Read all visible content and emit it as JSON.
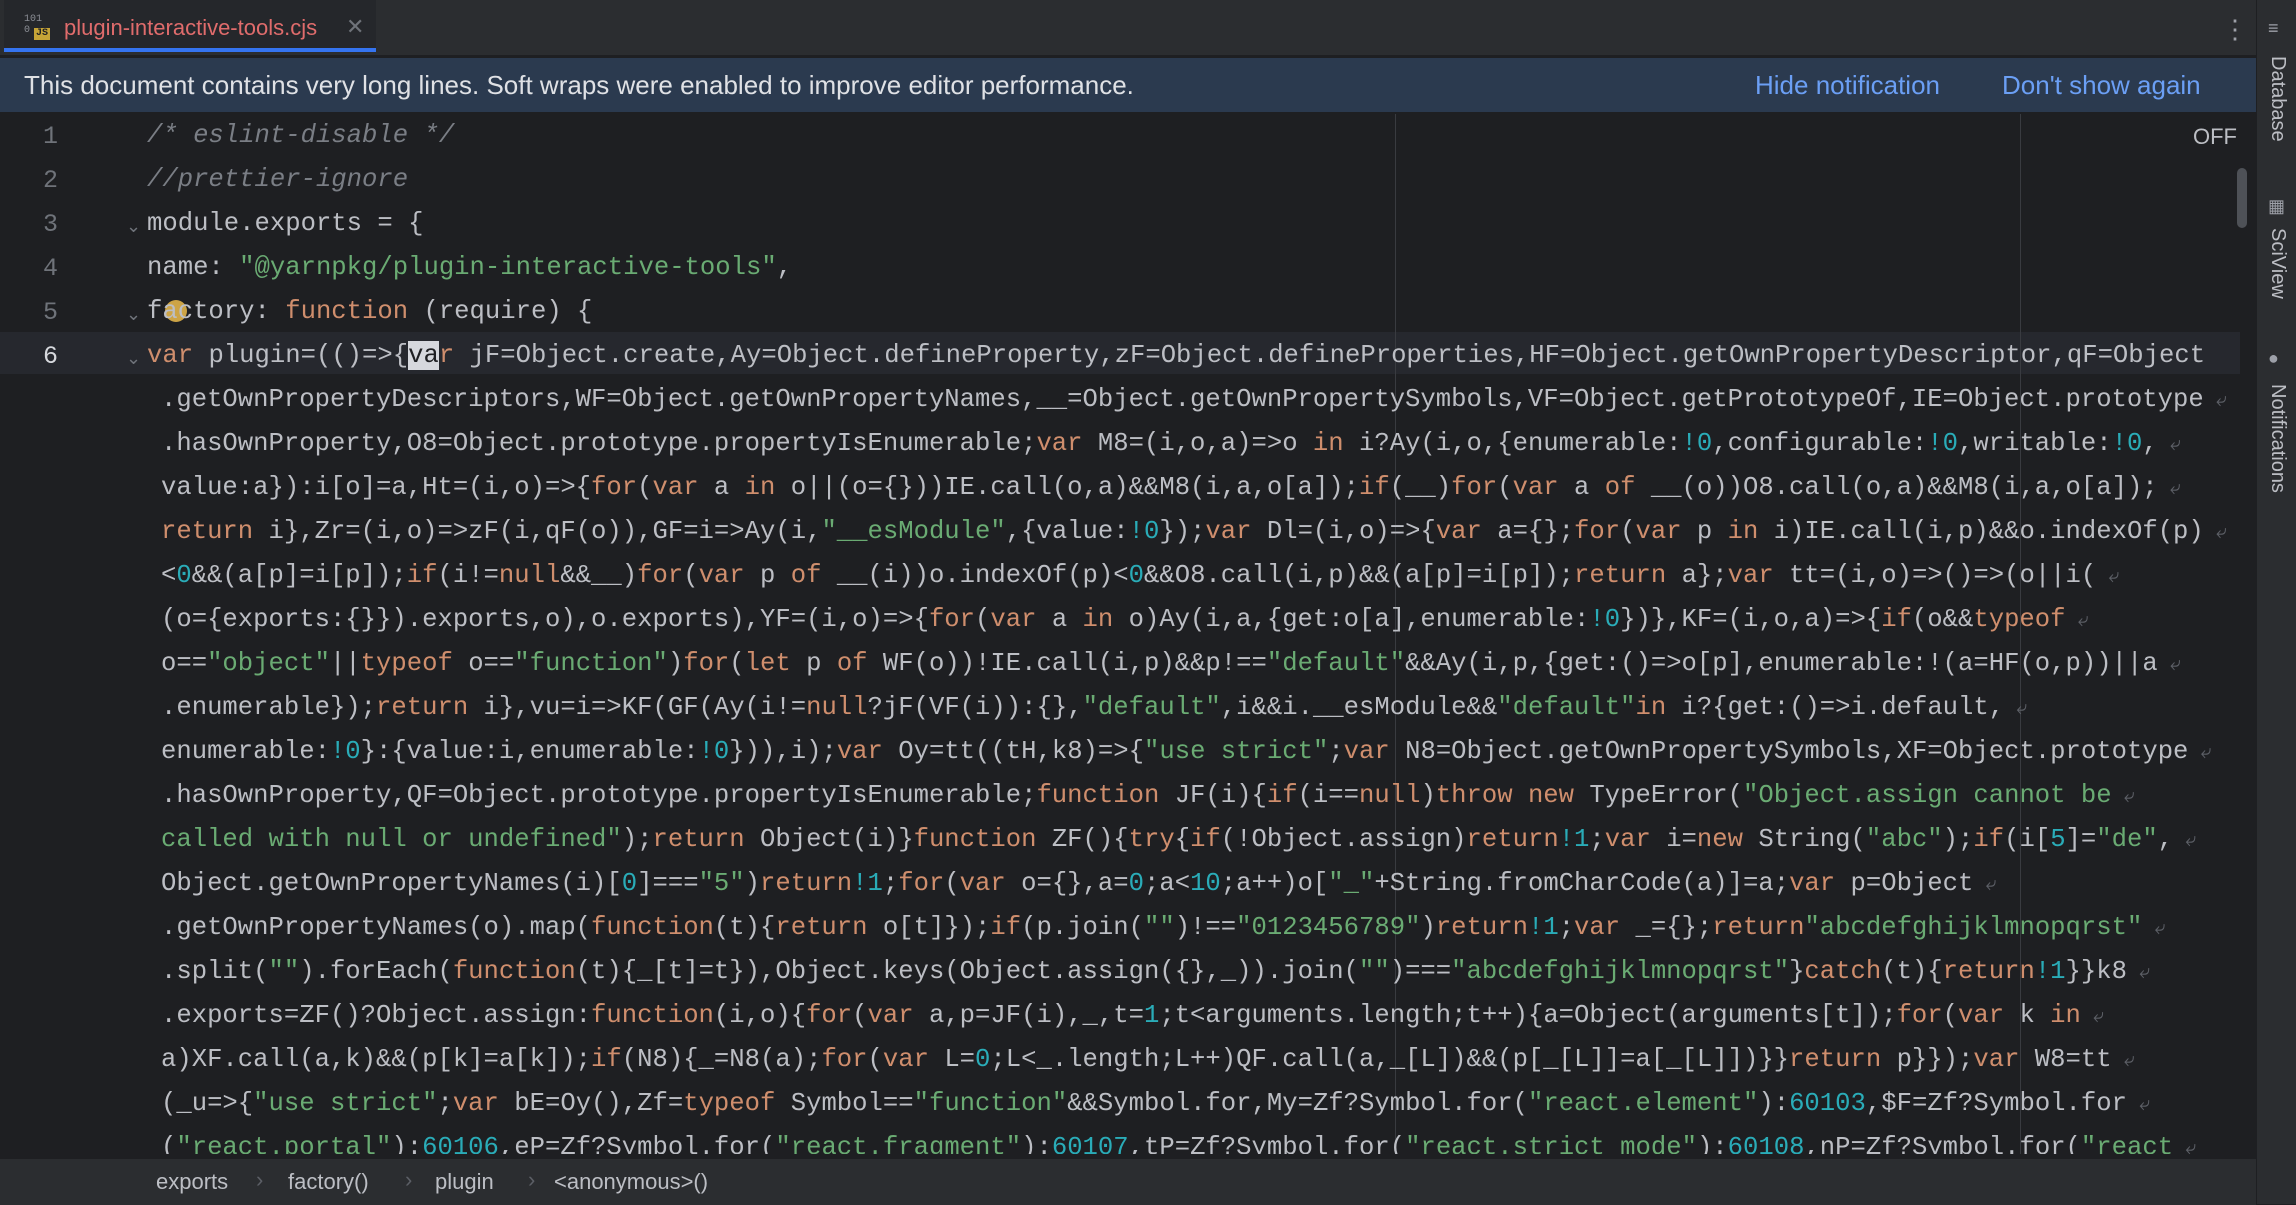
{
  "tab": {
    "file_icon_top": "101",
    "file_icon_bottom": "0",
    "file_icon_badge": "JS",
    "filename": "plugin-interactive-tools.cjs",
    "close_glyph": "✕"
  },
  "kebab_glyph": "⋮",
  "notification": {
    "message": "This document contains very long lines. Soft wraps were enabled to improve editor performance.",
    "hide_label": "Hide notification",
    "dont_show_label": "Don't show again"
  },
  "editor": {
    "toggle_label": "OFF",
    "line_numbers": [
      "1",
      "2",
      "3",
      "4",
      "5",
      "6"
    ],
    "current_line": "6"
  },
  "code_lines": [
    [
      [
        "cm",
        "/* eslint-disable */"
      ]
    ],
    [
      [
        "cm",
        "//prettier-ignore"
      ]
    ],
    [
      [
        "pl",
        "module.exports = {"
      ]
    ],
    [
      [
        "pl",
        "name: "
      ],
      [
        "st",
        "\"@yarnpkg/plugin-interactive-tools\""
      ],
      [
        "pl",
        ","
      ]
    ],
    [
      [
        "pl",
        "factory: "
      ],
      [
        "kw",
        "function "
      ],
      [
        "pl",
        "(require) {"
      ]
    ],
    [
      [
        "kw",
        "var "
      ],
      [
        "pl",
        "plugin=(()=>{"
      ],
      [
        "caret",
        "va"
      ],
      [
        "kw",
        "r "
      ],
      [
        "pl",
        "jF=Object.create,Ay=Object.defineProperty,zF=Object.defineProperties,HF=Object.getOwnPropertyDescriptor,qF=Object"
      ]
    ],
    [
      [
        "pl",
        ".getOwnPropertyDescriptors,WF=Object.getOwnPropertyNames,__=Object.getOwnPropertySymbols,VF=Object.getPrototypeOf,IE=Object.prototype"
      ]
    ],
    [
      [
        "pl",
        ".hasOwnProperty,O8=Object.prototype.propertyIsEnumerable;"
      ],
      [
        "kw",
        "var "
      ],
      [
        "pl",
        "M8=(i,o,a)=>o "
      ],
      [
        "kw",
        "in "
      ],
      [
        "pl",
        "i?Ay(i,o,{enumerable:"
      ],
      [
        "nm",
        "!0"
      ],
      [
        "pl",
        ",configurable:"
      ],
      [
        "nm",
        "!0"
      ],
      [
        "pl",
        ",writable:"
      ],
      [
        "nm",
        "!0"
      ],
      [
        "pl",
        ","
      ]
    ],
    [
      [
        "pl",
        "value:a}):i[o]=a,Ht=(i,o)=>{"
      ],
      [
        "kw",
        "for"
      ],
      [
        "pl",
        "("
      ],
      [
        "kw",
        "var "
      ],
      [
        "pl",
        "a "
      ],
      [
        "kw",
        "in "
      ],
      [
        "pl",
        "o||(o={}))IE.call(o,a)&&M8(i,a,o[a]);"
      ],
      [
        "kw",
        "if"
      ],
      [
        "pl",
        "(__)"
      ],
      [
        "kw",
        "for"
      ],
      [
        "pl",
        "("
      ],
      [
        "kw",
        "var "
      ],
      [
        "pl",
        "a "
      ],
      [
        "kw",
        "of "
      ],
      [
        "pl",
        "__(o))O8.call(o,a)&&M8(i,a,o[a]);"
      ]
    ],
    [
      [
        "kw",
        "return "
      ],
      [
        "pl",
        "i},Zr=(i,o)=>zF(i,qF(o)),GF=i=>Ay(i,"
      ],
      [
        "st",
        "\"__esModule\""
      ],
      [
        "pl",
        ",{value:"
      ],
      [
        "nm",
        "!0"
      ],
      [
        "pl",
        "});"
      ],
      [
        "kw",
        "var "
      ],
      [
        "pl",
        "Dl=(i,o)=>{"
      ],
      [
        "kw",
        "var "
      ],
      [
        "pl",
        "a={};"
      ],
      [
        "kw",
        "for"
      ],
      [
        "pl",
        "("
      ],
      [
        "kw",
        "var "
      ],
      [
        "pl",
        "p "
      ],
      [
        "kw",
        "in "
      ],
      [
        "pl",
        "i)IE.call(i,p)&&o.indexOf(p)"
      ]
    ],
    [
      [
        "pl",
        "<"
      ],
      [
        "nm",
        "0"
      ],
      [
        "pl",
        "&&(a[p]=i[p]);"
      ],
      [
        "kw",
        "if"
      ],
      [
        "pl",
        "(i!="
      ],
      [
        "kw",
        "null"
      ],
      [
        "pl",
        "&&__)"
      ],
      [
        "kw",
        "for"
      ],
      [
        "pl",
        "("
      ],
      [
        "kw",
        "var "
      ],
      [
        "pl",
        "p "
      ],
      [
        "kw",
        "of "
      ],
      [
        "pl",
        "__(i))o.indexOf(p)<"
      ],
      [
        "nm",
        "0"
      ],
      [
        "pl",
        "&&O8.call(i,p)&&(a[p]=i[p]);"
      ],
      [
        "kw",
        "return "
      ],
      [
        "pl",
        "a};"
      ],
      [
        "kw",
        "var "
      ],
      [
        "pl",
        "tt=(i,o)=>()=>(o||i("
      ]
    ],
    [
      [
        "pl",
        "(o={exports:{}}).exports,o),o.exports),YF=(i,o)=>{"
      ],
      [
        "kw",
        "for"
      ],
      [
        "pl",
        "("
      ],
      [
        "kw",
        "var "
      ],
      [
        "pl",
        "a "
      ],
      [
        "kw",
        "in "
      ],
      [
        "pl",
        "o)Ay(i,a,{get:o[a],enumerable:"
      ],
      [
        "nm",
        "!0"
      ],
      [
        "pl",
        "})},KF=(i,o,a)=>{"
      ],
      [
        "kw",
        "if"
      ],
      [
        "pl",
        "(o&&"
      ],
      [
        "kw",
        "typeof"
      ]
    ],
    [
      [
        "pl",
        "o=="
      ],
      [
        "st",
        "\"object\""
      ],
      [
        "pl",
        "||"
      ],
      [
        "kw",
        "typeof "
      ],
      [
        "pl",
        "o=="
      ],
      [
        "st",
        "\"function\""
      ],
      [
        "pl",
        ")"
      ],
      [
        "kw",
        "for"
      ],
      [
        "pl",
        "("
      ],
      [
        "kw",
        "let "
      ],
      [
        "pl",
        "p "
      ],
      [
        "kw",
        "of "
      ],
      [
        "pl",
        "WF(o))!IE.call(i,p)&&p!=="
      ],
      [
        "st",
        "\"default\""
      ],
      [
        "pl",
        "&&Ay(i,p,{get:()=>o[p],enumerable:!(a=HF(o,p))||a"
      ]
    ],
    [
      [
        "pl",
        ".enumerable});"
      ],
      [
        "kw",
        "return "
      ],
      [
        "pl",
        "i},vu=i=>KF(GF(Ay(i!="
      ],
      [
        "kw",
        "null"
      ],
      [
        "pl",
        "?jF(VF(i)):{},"
      ],
      [
        "st",
        "\"default\""
      ],
      [
        "pl",
        ",i&&i.__esModule&&"
      ],
      [
        "st",
        "\"default\""
      ],
      [
        "kw",
        "in "
      ],
      [
        "pl",
        "i?{get:()=>i.default,"
      ]
    ],
    [
      [
        "pl",
        "enumerable:"
      ],
      [
        "nm",
        "!0"
      ],
      [
        "pl",
        "}:{value:i,enumerable:"
      ],
      [
        "nm",
        "!0"
      ],
      [
        "pl",
        "})),i);"
      ],
      [
        "kw",
        "var "
      ],
      [
        "pl",
        "Oy=tt((tH,k8)=>{"
      ],
      [
        "st",
        "\"use strict\""
      ],
      [
        "pl",
        ";"
      ],
      [
        "kw",
        "var "
      ],
      [
        "pl",
        "N8=Object.getOwnPropertySymbols,XF=Object.prototype"
      ]
    ],
    [
      [
        "pl",
        ".hasOwnProperty,QF=Object.prototype.propertyIsEnumerable;"
      ],
      [
        "kw",
        "function "
      ],
      [
        "pl",
        "JF(i){"
      ],
      [
        "kw",
        "if"
      ],
      [
        "pl",
        "(i=="
      ],
      [
        "kw",
        "null"
      ],
      [
        "pl",
        ")"
      ],
      [
        "kw",
        "throw new "
      ],
      [
        "pl",
        "TypeError("
      ],
      [
        "st",
        "\"Object.assign cannot be"
      ]
    ],
    [
      [
        "st",
        "called with null or undefined\""
      ],
      [
        "pl",
        ");"
      ],
      [
        "kw",
        "return "
      ],
      [
        "pl",
        "Object(i)}"
      ],
      [
        "kw",
        "function "
      ],
      [
        "pl",
        "ZF(){"
      ],
      [
        "kw",
        "try"
      ],
      [
        "pl",
        "{"
      ],
      [
        "kw",
        "if"
      ],
      [
        "pl",
        "(!Object.assign)"
      ],
      [
        "kw",
        "return"
      ],
      [
        "nm",
        "!1"
      ],
      [
        "pl",
        ";"
      ],
      [
        "kw",
        "var "
      ],
      [
        "pl",
        "i="
      ],
      [
        "kw",
        "new "
      ],
      [
        "pl",
        "String("
      ],
      [
        "st",
        "\"abc\""
      ],
      [
        "pl",
        ");"
      ],
      [
        "kw",
        "if"
      ],
      [
        "pl",
        "(i["
      ],
      [
        "nm",
        "5"
      ],
      [
        "pl",
        "]="
      ],
      [
        "st",
        "\"de\""
      ],
      [
        "pl",
        ","
      ]
    ],
    [
      [
        "pl",
        "Object.getOwnPropertyNames(i)["
      ],
      [
        "nm",
        "0"
      ],
      [
        "pl",
        "]==="
      ],
      [
        "st",
        "\"5\""
      ],
      [
        "pl",
        ")"
      ],
      [
        "kw",
        "return"
      ],
      [
        "nm",
        "!1"
      ],
      [
        "pl",
        ";"
      ],
      [
        "kw",
        "for"
      ],
      [
        "pl",
        "("
      ],
      [
        "kw",
        "var "
      ],
      [
        "pl",
        "o={},a="
      ],
      [
        "nm",
        "0"
      ],
      [
        "pl",
        ";a<"
      ],
      [
        "nm",
        "10"
      ],
      [
        "pl",
        ";a++)o["
      ],
      [
        "st",
        "\"_\""
      ],
      [
        "pl",
        "+String.fromCharCode(a)]=a;"
      ],
      [
        "kw",
        "var "
      ],
      [
        "pl",
        "p=Object"
      ]
    ],
    [
      [
        "pl",
        ".getOwnPropertyNames(o).map("
      ],
      [
        "kw",
        "function"
      ],
      [
        "pl",
        "(t){"
      ],
      [
        "kw",
        "return "
      ],
      [
        "pl",
        "o[t]});"
      ],
      [
        "kw",
        "if"
      ],
      [
        "pl",
        "(p.join("
      ],
      [
        "st",
        "\"\""
      ],
      [
        "pl",
        ")!=="
      ],
      [
        "st",
        "\"0123456789\""
      ],
      [
        "pl",
        ")"
      ],
      [
        "kw",
        "return"
      ],
      [
        "nm",
        "!1"
      ],
      [
        "pl",
        ";"
      ],
      [
        "kw",
        "var "
      ],
      [
        "pl",
        "_={};"
      ],
      [
        "kw",
        "return"
      ],
      [
        "st",
        "\"abcdefghijklmnopqrst\""
      ]
    ],
    [
      [
        "pl",
        ".split("
      ],
      [
        "st",
        "\"\""
      ],
      [
        "pl",
        ").forEach("
      ],
      [
        "kw",
        "function"
      ],
      [
        "pl",
        "(t){_[t]=t}),Object.keys(Object.assign({},_)).join("
      ],
      [
        "st",
        "\"\""
      ],
      [
        "pl",
        ")==="
      ],
      [
        "st",
        "\"abcdefghijklmnopqrst\""
      ],
      [
        "pl",
        "}"
      ],
      [
        "kw",
        "catch"
      ],
      [
        "pl",
        "(t){"
      ],
      [
        "kw",
        "return"
      ],
      [
        "nm",
        "!1"
      ],
      [
        "pl",
        "}}k8"
      ]
    ],
    [
      [
        "pl",
        ".exports=ZF()?Object.assign:"
      ],
      [
        "kw",
        "function"
      ],
      [
        "pl",
        "(i,o){"
      ],
      [
        "kw",
        "for"
      ],
      [
        "pl",
        "("
      ],
      [
        "kw",
        "var "
      ],
      [
        "pl",
        "a,p=JF(i),_,t="
      ],
      [
        "nm",
        "1"
      ],
      [
        "pl",
        ";t<arguments.length;t++){a=Object(arguments[t]);"
      ],
      [
        "kw",
        "for"
      ],
      [
        "pl",
        "("
      ],
      [
        "kw",
        "var "
      ],
      [
        "pl",
        "k "
      ],
      [
        "kw",
        "in"
      ]
    ],
    [
      [
        "pl",
        "a)XF.call(a,k)&&(p[k]=a[k]);"
      ],
      [
        "kw",
        "if"
      ],
      [
        "pl",
        "(N8){_=N8(a);"
      ],
      [
        "kw",
        "for"
      ],
      [
        "pl",
        "("
      ],
      [
        "kw",
        "var "
      ],
      [
        "pl",
        "L="
      ],
      [
        "nm",
        "0"
      ],
      [
        "pl",
        ";L<_.length;L++)QF.call(a,_[L])&&(p[_[L]]=a[_[L]])}}"
      ],
      [
        "kw",
        "return "
      ],
      [
        "pl",
        "p}});"
      ],
      [
        "kw",
        "var "
      ],
      [
        "pl",
        "W8=tt"
      ]
    ],
    [
      [
        "pl",
        "(_u=>{"
      ],
      [
        "st",
        "\"use strict\""
      ],
      [
        "pl",
        ";"
      ],
      [
        "kw",
        "var "
      ],
      [
        "pl",
        "bE=Oy(),Zf="
      ],
      [
        "kw",
        "typeof "
      ],
      [
        "pl",
        "Symbol=="
      ],
      [
        "st",
        "\"function\""
      ],
      [
        "pl",
        "&&Symbol.for,My=Zf?Symbol.for("
      ],
      [
        "st",
        "\"react.element\""
      ],
      [
        "pl",
        "):"
      ],
      [
        "nm",
        "60103"
      ],
      [
        "pl",
        ",$F=Zf?Symbol.for"
      ]
    ],
    [
      [
        "pl",
        "("
      ],
      [
        "st",
        "\"react.portal\""
      ],
      [
        "pl",
        "):"
      ],
      [
        "nm",
        "60106"
      ],
      [
        "pl",
        ",eP=Zf?Symbol.for("
      ],
      [
        "st",
        "\"react.fragment\""
      ],
      [
        "pl",
        "):"
      ],
      [
        "nm",
        "60107"
      ],
      [
        "pl",
        ",tP=Zf?Symbol.for("
      ],
      [
        "st",
        "\"react.strict_mode\""
      ],
      [
        "pl",
        "):"
      ],
      [
        "nm",
        "60108"
      ],
      [
        "pl",
        ",nP=Zf?Symbol.for("
      ],
      [
        "st",
        "\"react"
      ]
    ]
  ],
  "sidebar_right": {
    "database_label": "Database",
    "sciview_label": "SciView",
    "notifications_label": "Notifications"
  },
  "breadcrumbs": [
    "exports",
    "factory()",
    "plugin",
    "<anonymous>()"
  ]
}
